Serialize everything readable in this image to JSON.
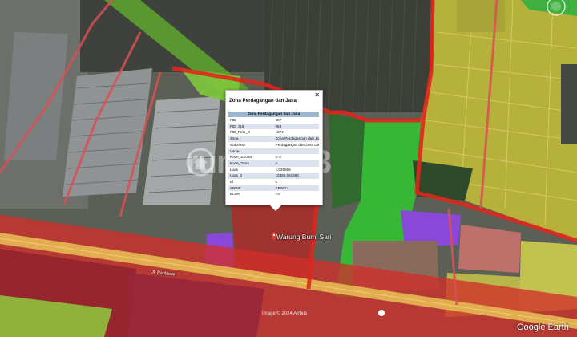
{
  "popup": {
    "title": "Zona Perdagangan dan Jasa",
    "table_header": "Zona Perdagangan dan Jasa",
    "rows": [
      {
        "key": "FID",
        "value": "967"
      },
      {
        "key": "FID_z16",
        "value": "993"
      },
      {
        "key": "FID_Pola_R",
        "value": "1874"
      },
      {
        "key": "Zona",
        "value": "Zona Perdagangan dan Jasa"
      },
      {
        "key": "SubZona",
        "value": "Perdagangan dan Jasa Deret"
      },
      {
        "key": "Varian",
        "value": ""
      },
      {
        "key": "Kode_SZona",
        "value": "K-3"
      },
      {
        "key": "Kode_Zona",
        "value": "K"
      },
      {
        "key": "Luas",
        "value": "1.039568"
      },
      {
        "key": "Luas_2",
        "value": "10395.681480"
      },
      {
        "key": "Id",
        "value": "0"
      },
      {
        "key": "SBWP",
        "value": "SBWP I"
      },
      {
        "key": "BLOK",
        "value": "I-3"
      }
    ]
  },
  "map": {
    "place_label": "Warung Bumi Sari",
    "road_label": "Jl. Pahlawan",
    "imagery_credit": "Image © 2024 Airbus",
    "brand": "Google Earth",
    "watermark": "rumah123",
    "legend_colors": {
      "trade_zone": "#c81e1e",
      "housing_zone": "#e6e632",
      "green_zone": "#1fbe2a",
      "public_facility_zone": "#8a3fe0",
      "agriculture_zone": "#44aa22"
    },
    "icons": [
      "place-pin-icon",
      "close-icon",
      "compass-icon",
      "info-icon",
      "watermark-logo-icon"
    ]
  }
}
